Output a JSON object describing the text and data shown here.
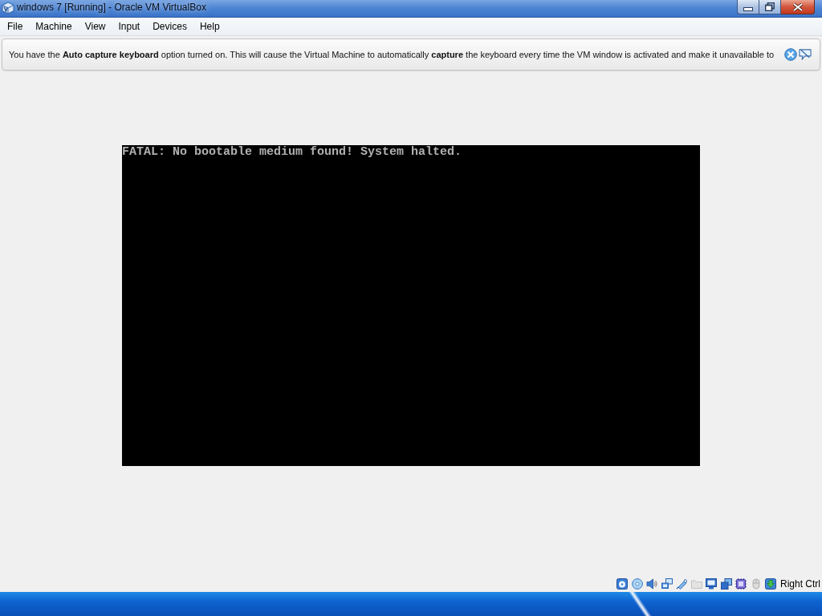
{
  "window": {
    "title": "windows 7 [Running] - Oracle VM VirtualBox"
  },
  "menu": [
    "File",
    "Machine",
    "View",
    "Input",
    "Devices",
    "Help"
  ],
  "notice": {
    "text": "You have the **Auto capture keyboard** option turned on. This will cause the Virtual Machine to automatically **capture** the keyboard every time the VM window is activated and make it unavailable to"
  },
  "vm_screen": {
    "lines": [
      "FATAL: No bootable medium found! System halted."
    ]
  },
  "status_bar": {
    "indicators": [
      {
        "kind": "storage",
        "disabled": false
      },
      {
        "kind": "optical",
        "disabled": false
      },
      {
        "kind": "audio",
        "disabled": false
      },
      {
        "kind": "network",
        "disabled": false
      },
      {
        "kind": "usb",
        "disabled": false
      },
      {
        "kind": "shared",
        "disabled": true
      },
      {
        "kind": "display",
        "disabled": false
      },
      {
        "kind": "capture",
        "disabled": false
      },
      {
        "kind": "vtx",
        "disabled": false
      },
      {
        "kind": "mouse",
        "disabled": true
      },
      {
        "kind": "keyboard",
        "disabled": false
      }
    ],
    "host_key": "Right Ctrl"
  }
}
